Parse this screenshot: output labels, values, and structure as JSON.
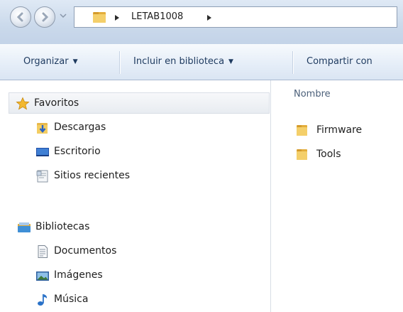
{
  "address": {
    "crumbs": [
      "LETAB1008"
    ]
  },
  "toolbar": {
    "organize_label": "Organizar",
    "include_label": "Incluir en biblioteca",
    "share_label": "Compartir con"
  },
  "navigation": {
    "favorites": {
      "label": "Favoritos",
      "items": [
        {
          "label": "Descargas",
          "icon": "downloads-folder-icon"
        },
        {
          "label": "Escritorio",
          "icon": "desktop-icon"
        },
        {
          "label": "Sitios recientes",
          "icon": "recent-places-icon"
        }
      ]
    },
    "libraries": {
      "label": "Bibliotecas",
      "items": [
        {
          "label": "Documentos",
          "icon": "documents-icon"
        },
        {
          "label": "Imágenes",
          "icon": "pictures-icon"
        },
        {
          "label": "Música",
          "icon": "music-icon"
        }
      ]
    }
  },
  "content": {
    "column_name": "Nombre",
    "files": [
      {
        "name": "Firmware",
        "icon": "folder-icon"
      },
      {
        "name": "Tools",
        "icon": "folder-icon"
      }
    ]
  },
  "colors": {
    "folder": "#e8b84a",
    "title_gradient": "#cad9eb",
    "command_text": "#1e3a5f"
  }
}
